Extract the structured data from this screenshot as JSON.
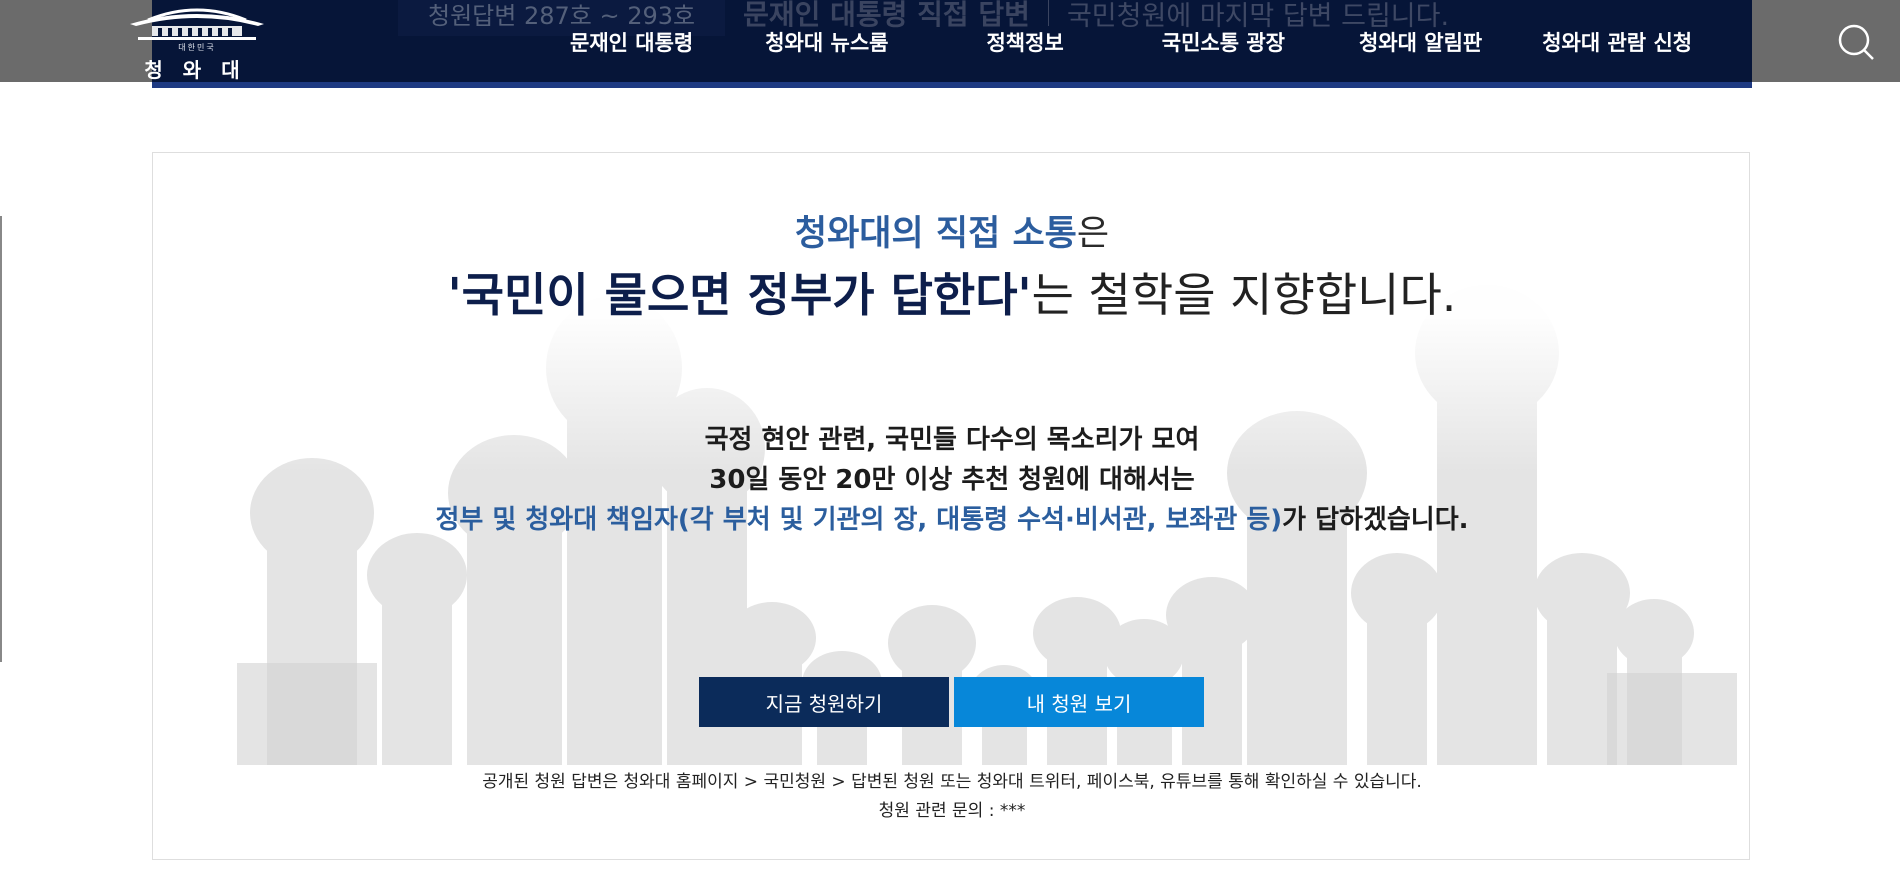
{
  "ticker": {
    "tag": "청원답변 287호 ~ 293호",
    "headline": "문재인 대통령 직접 답변",
    "subline": "국민청원에 마지막 답변 드립니다."
  },
  "logo": {
    "subtitle": "대한민국",
    "title": "청와대"
  },
  "nav": {
    "items": [
      {
        "label": "문재인 대통령"
      },
      {
        "label": "청와대 뉴스룸"
      },
      {
        "label": "정책정보"
      },
      {
        "label": "국민소통 광장"
      },
      {
        "label": "청와대 알림판"
      },
      {
        "label": "청와대 관람 신청"
      }
    ]
  },
  "hero": {
    "line1_highlight": "청와대의 직접 소통",
    "line1_rest": "은",
    "line2_highlight": "'국민이 물으면 정부가 답한다'",
    "line2_rest": "는 철학을 지향합니다.",
    "line3": "국정 현안 관련, 국민들 다수의 목소리가 모여",
    "line4": "30일 동안 20만 이상 추천 청원에 대해서는",
    "line5_highlight": "정부 및 청와대 책임자(각 부처 및 기관의 장, 대통령 수석·비서관, 보좌관 등)",
    "line5_rest": "가 답하겠습니다."
  },
  "buttons": {
    "petition_now": "지금 청원하기",
    "my_petitions": "내 청원 보기"
  },
  "notes": {
    "line1": "공개된 청원 답변은 청와대 홈페이지 > 국민청원 > 답변된 청원 또는 청와대 트위터, 페이스북, 유튜브를 통해 확인하실 수 있습니다.",
    "line2": "청원 관련 문의 : ***"
  },
  "colors": {
    "nav_bg": "#061538",
    "nav_accent": "#1e3a82",
    "primary_button": "#0b2b5a",
    "secondary_button": "#0787d9",
    "highlight_text": "#2c5d9e"
  },
  "icons": {
    "search": "search-icon",
    "logo": "blue-house-logo-icon"
  }
}
